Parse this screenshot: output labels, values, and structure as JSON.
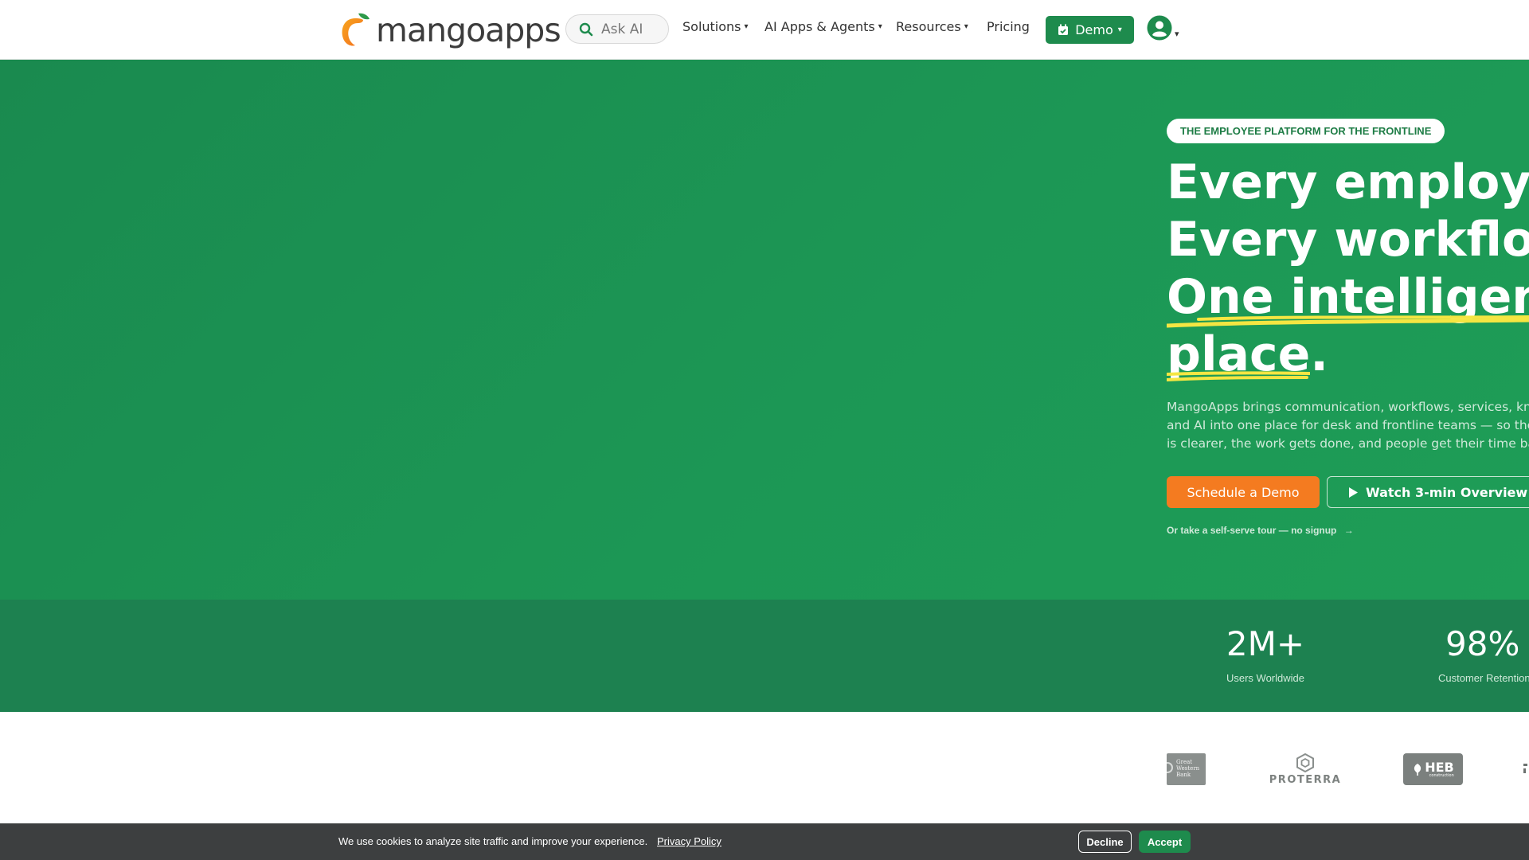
{
  "nav": {
    "brand": "mangoapps",
    "search_placeholder": "Ask AI",
    "items": [
      {
        "label": "Solutions"
      },
      {
        "label": "AI Apps & Agents"
      },
      {
        "label": "Resources"
      },
      {
        "label": "Pricing"
      }
    ],
    "demo_label": "Demo"
  },
  "hero": {
    "eyebrow": "THE EMPLOYEE PLATFORM FOR THE FRONTLINE",
    "headline": [
      "Every employee.",
      "Every workflow.",
      "One intelligent",
      "place."
    ],
    "description": [
      "MangoApps brings communication, workflows, services, knowledge,",
      "and AI into one place for desk and frontline teams — so the work",
      "is clearer, the work gets done, and people get their time back."
    ],
    "primary_cta": "Schedule a Demo",
    "secondary_cta": "Watch 3-min Overview",
    "self_tour": "Or take a self-serve tour — no signup"
  },
  "stats": [
    {
      "value": "2M+",
      "label": "Users Worldwide"
    },
    {
      "value": "98%",
      "label": "Customer Retention"
    }
  ],
  "logos": {
    "great_western": [
      "Great",
      "Western",
      "Bank"
    ],
    "proterra": "PROTERRA",
    "heb": "HEB",
    "heb_sub": "construction"
  },
  "cookie": {
    "message": "We use cookies to analyze site traffic and improve your experience.",
    "privacy": "Privacy Policy",
    "decline": "Decline",
    "accept": "Accept"
  },
  "colors": {
    "brand_green": "#1e8b4d",
    "hero_green": "#1c9755",
    "stats_green": "#1d8150",
    "cta_orange": "#f47b20",
    "highlight_yellow": "#f5e642"
  }
}
